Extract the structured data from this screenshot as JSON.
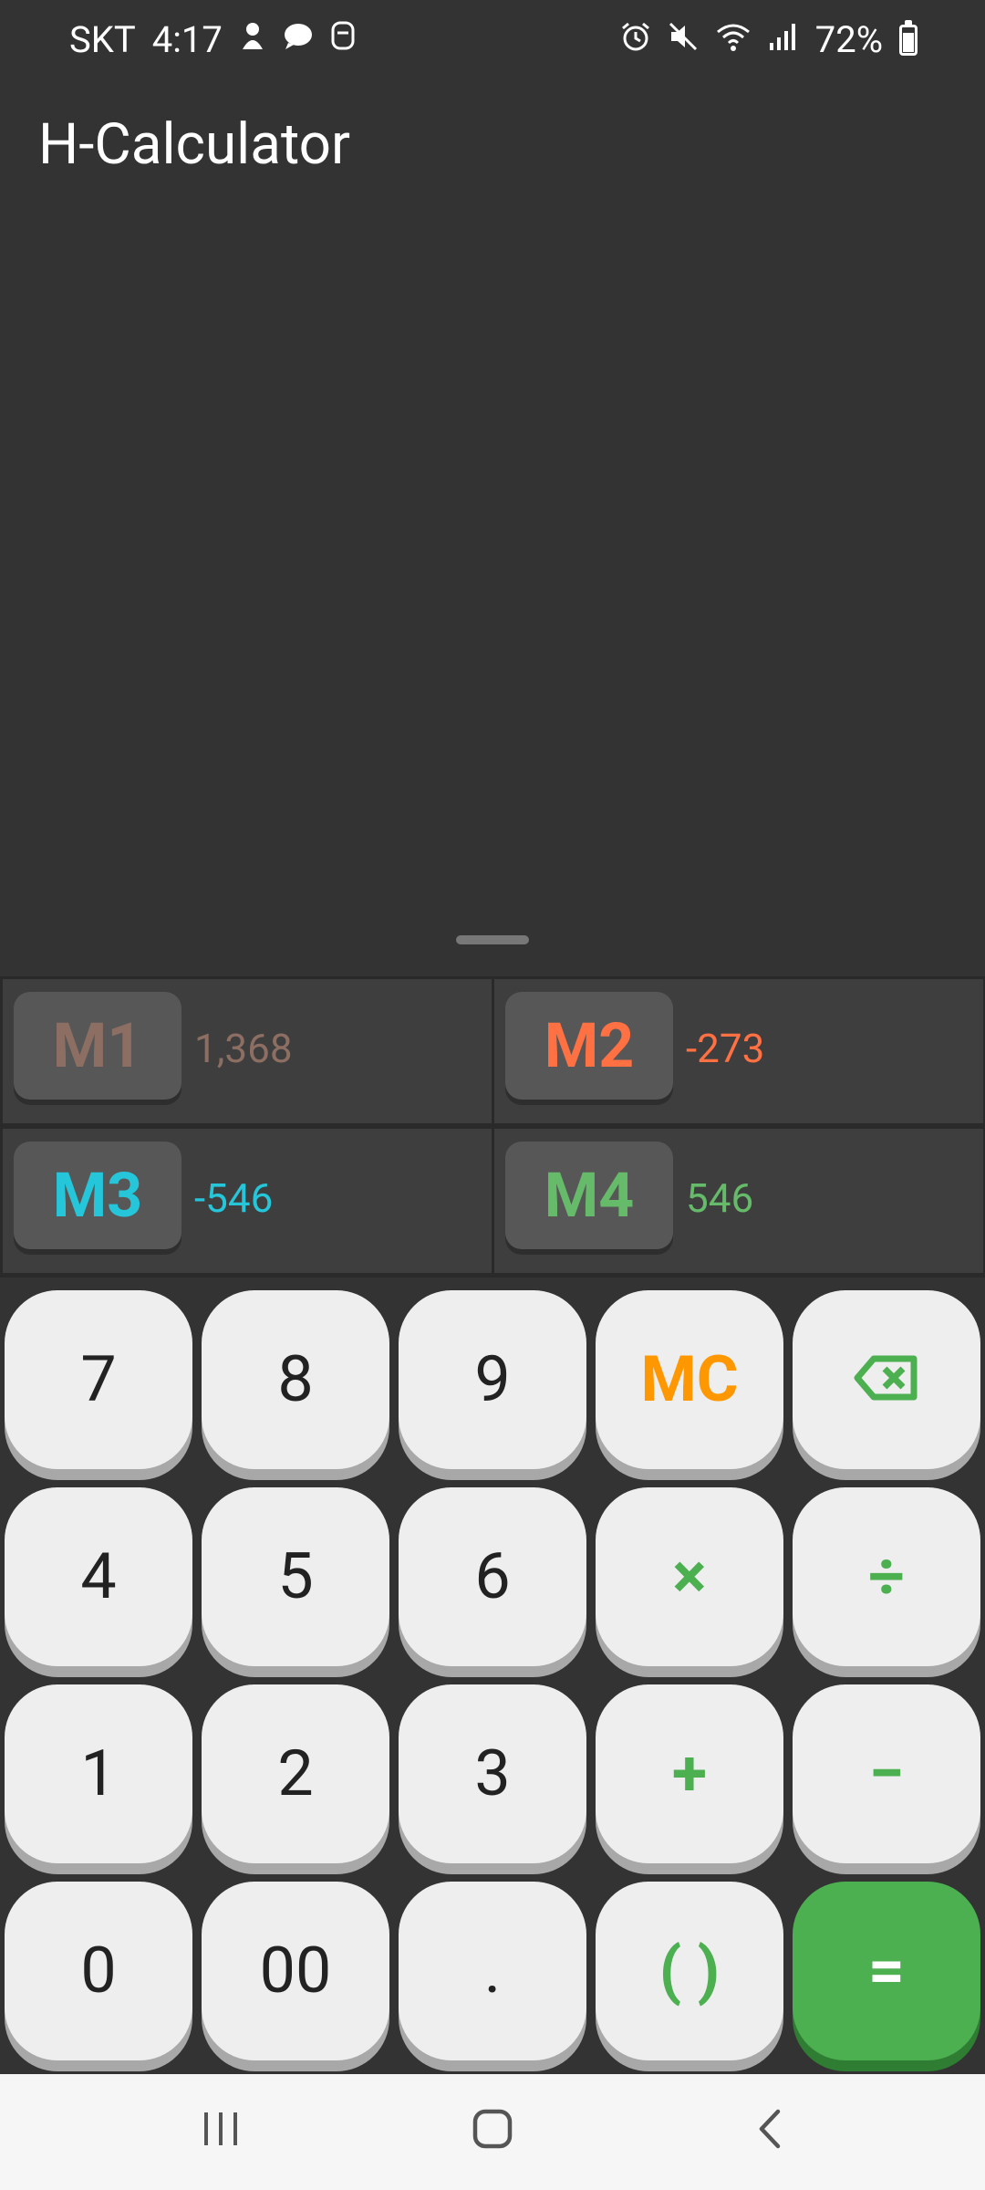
{
  "status_bar": {
    "carrier": "SKT",
    "time": "4:17",
    "battery": "72%"
  },
  "app": {
    "title": "H-Calculator"
  },
  "memory": [
    {
      "label": "M1",
      "value": "1,368",
      "color": "#8d6e63"
    },
    {
      "label": "M2",
      "value": "-273",
      "color": "#ff7043"
    },
    {
      "label": "M3",
      "value": "-546",
      "color": "#26c6da"
    },
    {
      "label": "M4",
      "value": "546",
      "color": "#66bb6a"
    }
  ],
  "keypad": {
    "row1": [
      "7",
      "8",
      "9",
      "MC",
      "⌫"
    ],
    "row2": [
      "4",
      "5",
      "6",
      "×",
      "÷"
    ],
    "row3": [
      "1",
      "2",
      "3",
      "+",
      "−"
    ],
    "row4": [
      "0",
      "00",
      ".",
      "( )",
      "="
    ]
  },
  "colors": {
    "accent_green": "#4caf50",
    "mc_orange": "#ff9800",
    "background": "#333333"
  },
  "icons": {
    "backspace": "backspace-icon",
    "recents": "recents-icon",
    "home": "home-icon",
    "back": "back-icon"
  }
}
